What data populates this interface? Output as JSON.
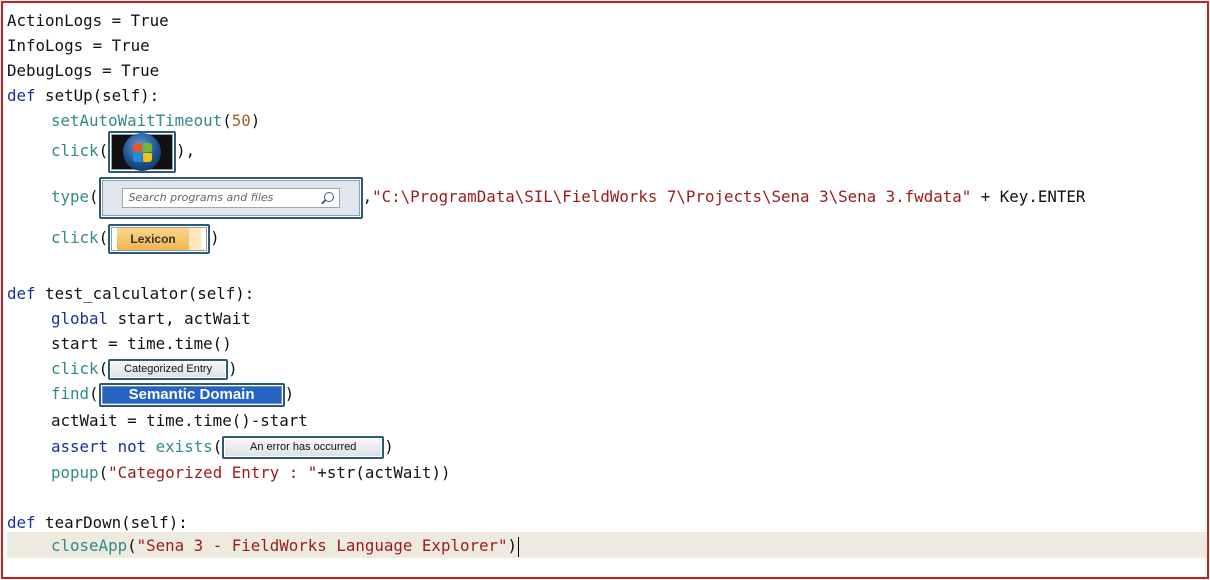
{
  "colors": {
    "frame_border": "#cc1f1f",
    "keyword": "#1a2f9c",
    "function": "#318a8a",
    "string": "#9c1a1a",
    "number": "#a0641a",
    "current_line": "#ecebdd"
  },
  "icons": {
    "start_orb": "windows-start-orb-icon",
    "search": "search-icon"
  },
  "lines": {
    "l1": "ActionLogs = True",
    "l2": "InfoLogs = True",
    "l3": "DebugLogs = True",
    "def": "def",
    "setup_sig": " setUp(self):",
    "setAutoWaitTimeout": "setAutoWaitTimeout",
    "open_paren": "(",
    "fifty": "50",
    "close_paren": ")",
    "click": "click",
    "close_paren_comma": "),",
    "type": "type",
    "comma": ",",
    "path_string": "\"C:\\ProgramData\\SIL\\FieldWorks 7\\Projects\\Sena 3\\Sena 3.fwdata\"",
    "plus_key_enter": " + Key.ENTER",
    "test_sig": " test_calculator(self):",
    "global": "global",
    "global_rest": " start, actWait",
    "start_assign": "start = time.time()",
    "find": "find",
    "actwait_assign": "actWait = time.time()-start",
    "assert": "assert",
    "not": "not",
    "exists": "exists",
    "popup": "popup",
    "popup_string": "\"Categorized Entry : \"",
    "popup_rest": "+str(actWait))",
    "teardown_sig": " tearDown(self):",
    "closeApp": "closeApp",
    "closeapp_string": "\"Sena 3 - FieldWorks Language Explorer\"",
    "space": " "
  },
  "captures": {
    "search_placeholder": "Search programs and files",
    "lexicon": "Lexicon",
    "categorized_entry": "Categorized Entry",
    "semantic_domain": "Semantic Domain",
    "error_occurred": "An error has occurred"
  }
}
